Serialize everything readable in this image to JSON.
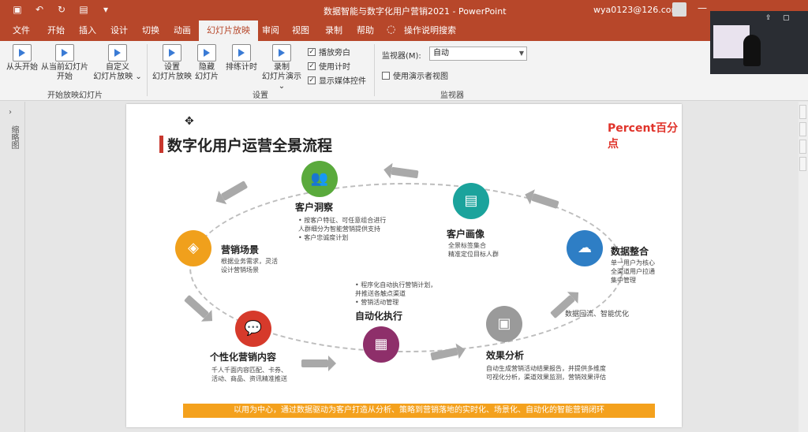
{
  "titlebar": {
    "doc_title": "数据智能与数字化用户营销2021  -  PowerPoint",
    "account": "wya0123@126.com",
    "qat_icons": [
      "save-icon",
      "undo-icon",
      "redo-icon",
      "present-icon",
      "more-icon"
    ]
  },
  "tabs": [
    "文件",
    "开始",
    "插入",
    "设计",
    "切换",
    "动画",
    "幻灯片放映",
    "审阅",
    "视图",
    "录制",
    "帮助",
    "操作说明搜索"
  ],
  "active_tab": "幻灯片放映",
  "ribbon": {
    "start_group": {
      "label": "开始放映幻灯片",
      "from_start": "从头开始",
      "from_current_l1": "从当前幻灯片",
      "from_current_l2": "开始",
      "custom_l1": "自定义",
      "custom_l2": "幻灯片放映 ⌄"
    },
    "setup_group": {
      "label": "设置",
      "setup_l1": "设置",
      "setup_l2": "幻灯片放映",
      "hide_l1": "隐藏",
      "hide_l2": "幻灯片",
      "rehearse": "排练计时",
      "record_l1": "录制",
      "record_l2": "幻灯片演示 ⌄",
      "play_narration": "播放旁白",
      "use_timings": "使用计时",
      "show_media": "显示媒体控件"
    },
    "monitor_group": {
      "label": "监视器",
      "monitor_label": "监视器(M):",
      "monitor_value": "自动",
      "presenter_view": "使用演示者视图"
    }
  },
  "left_pane": {
    "label": "缩略图"
  },
  "slide": {
    "title": "数字化用户运营全景流程",
    "brand": "Percent百分点",
    "nodes": {
      "insight": {
        "title": "客户洞察",
        "d1": "• 按客户特征、可任意组合进行",
        "d2": "  人群细分为智能营销提供支持",
        "d3": "• 客户忠诚度计划",
        "color": "#5aaa3c"
      },
      "portrait": {
        "title": "客户画像",
        "d1": "全景标签集合",
        "d2": "精准定位目标人群",
        "color": "#1ba39c"
      },
      "integration": {
        "title": "数据整合",
        "d1": "单一用户为核心",
        "d2": "全渠道用户拉通",
        "d3": "集中管理",
        "color": "#2e7ec5"
      },
      "scene": {
        "title": "营销场景",
        "d1": "根据业务需求，灵活",
        "d2": "设计营销场景",
        "color": "#f0a01c"
      },
      "automation": {
        "title": "自动化执行",
        "d1": "• 程序化自动执行营销计划，",
        "d2": "  并推送各触点渠道",
        "d3": "• 营销活动管理",
        "color": "#8e2f6a"
      },
      "content": {
        "title": "个性化营销内容",
        "d1": "千人千面内容匹配、卡券、",
        "d2": "活动、商品、资讯精准推送",
        "color": "#d63a2b"
      },
      "effect": {
        "title": "效果分析",
        "d1": "自动生成营销活动结果报告，并提供多维度",
        "d2": "可视化分析，渠道效果监测，营销效果评估",
        "color": "#9a9a9a"
      }
    },
    "feedback_label": "数据回流、智能优化",
    "banner": "以用为中心，通过数据驱动为客户打造从分析、策略到营销落地的实时化、场景化、自动化的智能营销闭环"
  }
}
